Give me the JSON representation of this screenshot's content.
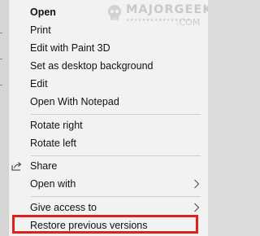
{
  "watermark": {
    "title": "MAJORGEEKS",
    "subtitle": ".COM"
  },
  "context_menu": {
    "items": [
      {
        "label": "Open",
        "bold": true
      },
      {
        "label": "Print"
      },
      {
        "label": "Edit with Paint 3D"
      },
      {
        "label": "Set as desktop background"
      },
      {
        "label": "Edit"
      },
      {
        "label": "Open With Notepad"
      },
      {
        "label": "Rotate right"
      },
      {
        "label": "Rotate left"
      },
      {
        "label": "Share",
        "icon": "share-icon"
      },
      {
        "label": "Open with",
        "has_submenu": true
      },
      {
        "label": "Give access to",
        "has_submenu": true
      },
      {
        "label": "Restore previous versions",
        "highlighted": true
      }
    ]
  },
  "colors": {
    "menu_background": "#f2f2f2",
    "separator": "#cdcdcd",
    "highlight_border": "#e0201a",
    "text": "#111111"
  }
}
